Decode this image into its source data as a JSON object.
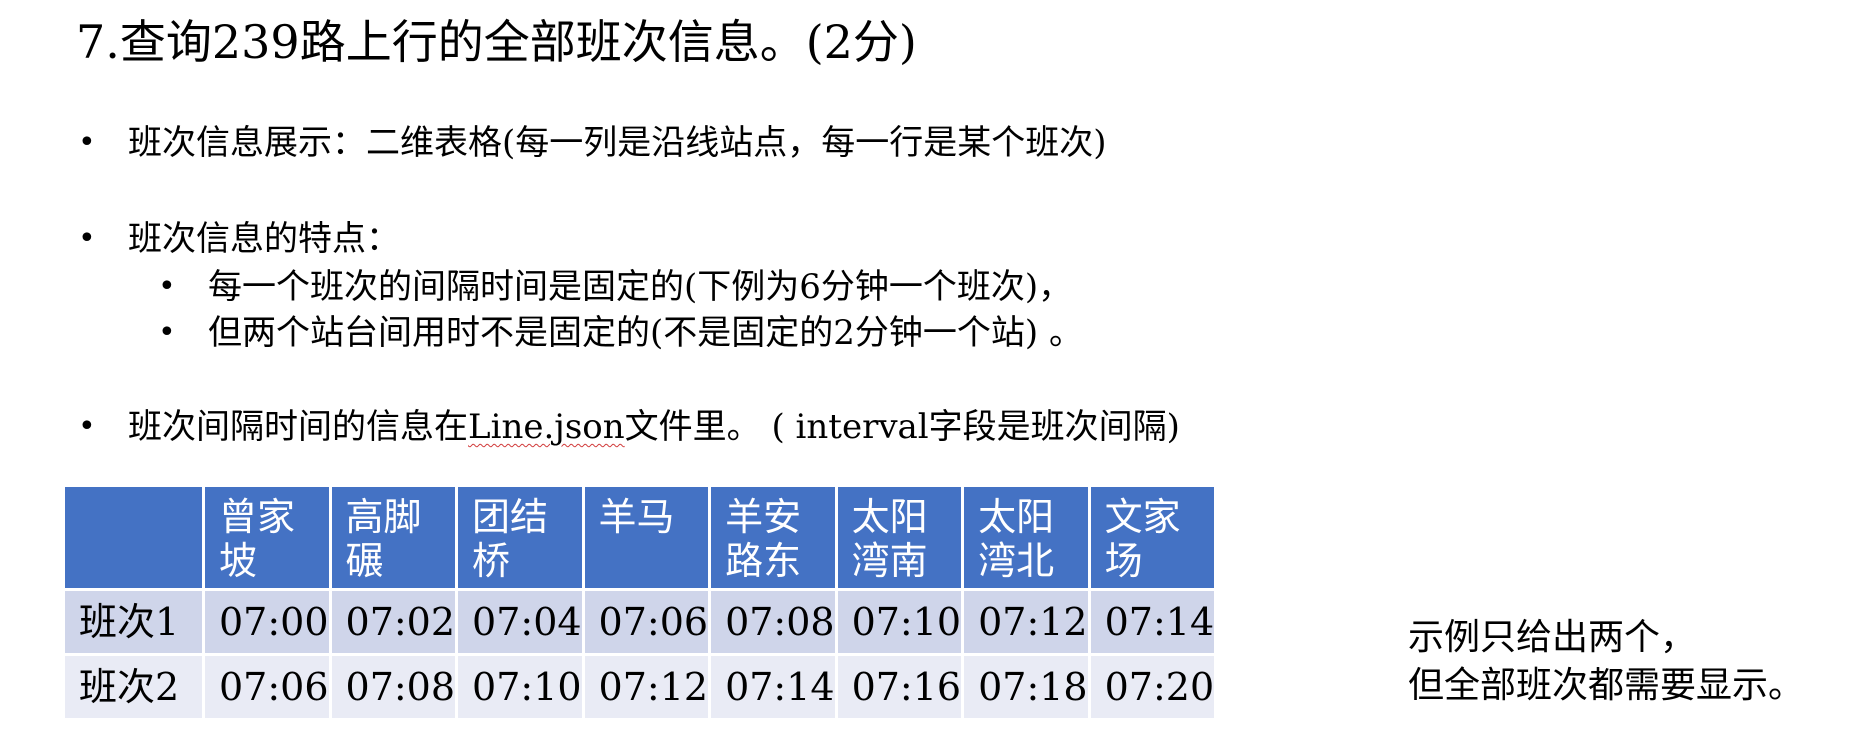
{
  "title": "7.查询239路上行的全部班次信息。(2分)",
  "bullets": {
    "b1": "班次信息展示：二维表格(每一列是沿线站点，每一行是某个班次)",
    "b2": "班次信息的特点：",
    "b2_sub1": "每一个班次的间隔时间是固定的(下例为6分钟一个班次)，",
    "b2_sub2": "但两个站台间用时不是固定的(不是固定的2分钟一个站) 。",
    "b3_part1": "班次间隔时间的信息在",
    "b3_file": "Line.json",
    "b3_part2": "文件里。 ( interval字段是班次间隔)"
  },
  "bullet_symbol": "•",
  "table": {
    "headers": [
      "",
      "曾家坡",
      "高脚碾",
      "团结桥",
      "羊马",
      "羊安路东",
      "太阳湾南",
      "太阳湾北",
      "文家场"
    ],
    "rows": [
      {
        "label": "班次1",
        "times": [
          "07:00",
          "07:02",
          "07:04",
          "07:06",
          "07:08",
          "07:10",
          "07:12",
          "07:14"
        ]
      },
      {
        "label": "班次2",
        "times": [
          "07:06",
          "07:08",
          "07:10",
          "07:12",
          "07:14",
          "07:16",
          "07:18",
          "07:20"
        ]
      }
    ]
  },
  "note": {
    "line1": "示例只给出两个，",
    "line2": "但全部班次都需要显示。"
  },
  "colors": {
    "header_bg": "#4472c4",
    "row1_bg": "#cfd5ea",
    "row2_bg": "#e9ebf5"
  }
}
